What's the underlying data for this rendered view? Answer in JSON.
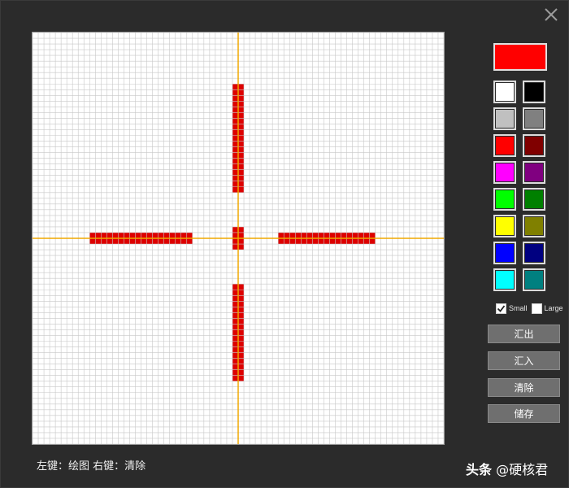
{
  "window": {
    "close_icon": "close-icon"
  },
  "canvas": {
    "grid_cells": 72,
    "grid_line_color": "#c8c8c8",
    "guide_color": "#f0a800",
    "guide_cell": 36,
    "pixel_color": "#dd0000",
    "pixel_blocks": [
      {
        "name": "top-arm",
        "col_start": 35,
        "col_end": 36,
        "row_start": 9,
        "row_end": 27
      },
      {
        "name": "bottom-arm",
        "col_start": 35,
        "col_end": 36,
        "row_start": 44,
        "row_end": 60
      },
      {
        "name": "left-arm",
        "col_start": 10,
        "col_end": 27,
        "row_start": 35,
        "row_end": 36
      },
      {
        "name": "right-arm",
        "col_start": 43,
        "col_end": 59,
        "row_start": 35,
        "row_end": 36
      },
      {
        "name": "center-dot",
        "col_start": 35,
        "col_end": 36,
        "row_start": 34,
        "row_end": 37
      }
    ]
  },
  "current_color": "#ff0000",
  "palette": [
    {
      "name": "white",
      "color": "#ffffff"
    },
    {
      "name": "black",
      "color": "#000000"
    },
    {
      "name": "light-gray",
      "color": "#c0c0c0"
    },
    {
      "name": "gray",
      "color": "#808080"
    },
    {
      "name": "red",
      "color": "#ff0000"
    },
    {
      "name": "maroon",
      "color": "#800000"
    },
    {
      "name": "magenta",
      "color": "#ff00ff"
    },
    {
      "name": "purple",
      "color": "#800080"
    },
    {
      "name": "lime",
      "color": "#00ff00"
    },
    {
      "name": "green",
      "color": "#008000"
    },
    {
      "name": "yellow",
      "color": "#ffff00"
    },
    {
      "name": "olive",
      "color": "#808000"
    },
    {
      "name": "blue",
      "color": "#0000ff"
    },
    {
      "name": "navy",
      "color": "#000080"
    },
    {
      "name": "cyan",
      "color": "#00ffff"
    },
    {
      "name": "teal",
      "color": "#008080"
    }
  ],
  "brush_size": {
    "small_label": "Small",
    "small_checked": true,
    "large_label": "Large",
    "large_checked": false
  },
  "buttons": {
    "export_label": "汇出",
    "import_label": "汇入",
    "clear_label": "清除",
    "save_label": "储存"
  },
  "hint": "左键：绘图 右键：清除",
  "watermark": {
    "brand": "头条",
    "handle": "@硬核君"
  }
}
